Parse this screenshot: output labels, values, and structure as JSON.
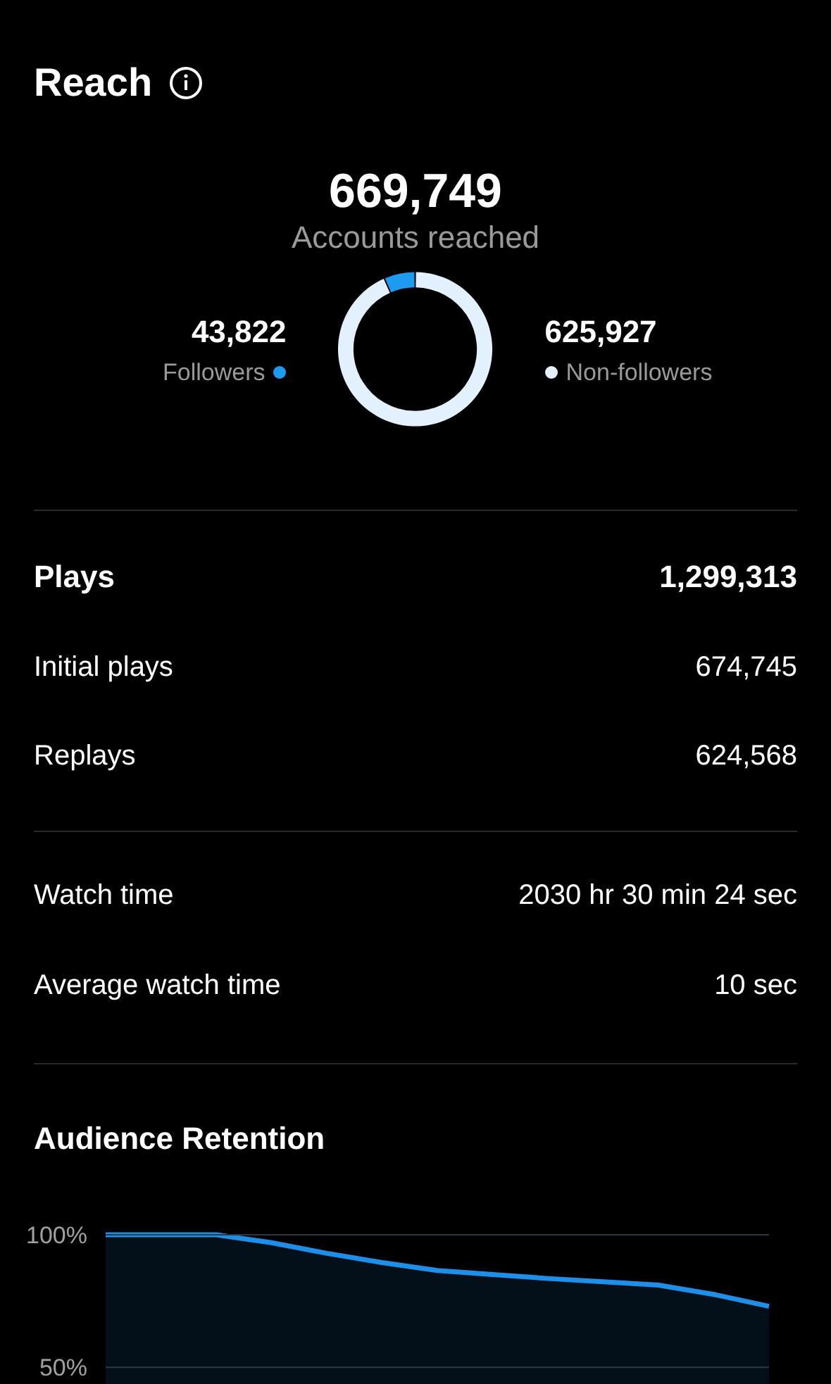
{
  "reach": {
    "title": "Reach",
    "total": "669,749",
    "total_label": "Accounts reached",
    "legend": [
      {
        "value": "43,822",
        "color": "#1d9bf0"
      },
      {
        "value": "625,927",
        "color": "#e3f0fd"
      }
    ],
    "chart_data": {
      "type": "donut",
      "categories": [
        "Followers",
        "Non-followers"
      ],
      "values": [
        6.54,
        93.46
      ]
    }
  },
  "plays": {
    "label": "Plays",
    "value": "1,299,313",
    "rows": [
      {
        "label": "Initial plays",
        "value": "674,745"
      },
      {
        "label": "Replays",
        "value": "624,568"
      }
    ]
  },
  "watch": [
    {
      "label": "Watch time",
      "value": "2030 hr 30 min 24 sec"
    },
    {
      "label": "Average watch time",
      "value": "10 sec"
    }
  ],
  "retention": {
    "title": "Audience Retention",
    "chart_data": {
      "type": "area",
      "series": [
        {
          "color": "#1d8fe8",
          "values": [
            100,
            100,
            100,
            97,
            93,
            89.5,
            86.5,
            85,
            83.5,
            82.3,
            81,
            77.5,
            73
          ]
        }
      ],
      "ylim": [
        32,
        100
      ],
      "yticks": [
        {
          "value": 100,
          "label": "100%"
        },
        {
          "value": 50,
          "label": "50%"
        }
      ]
    }
  }
}
